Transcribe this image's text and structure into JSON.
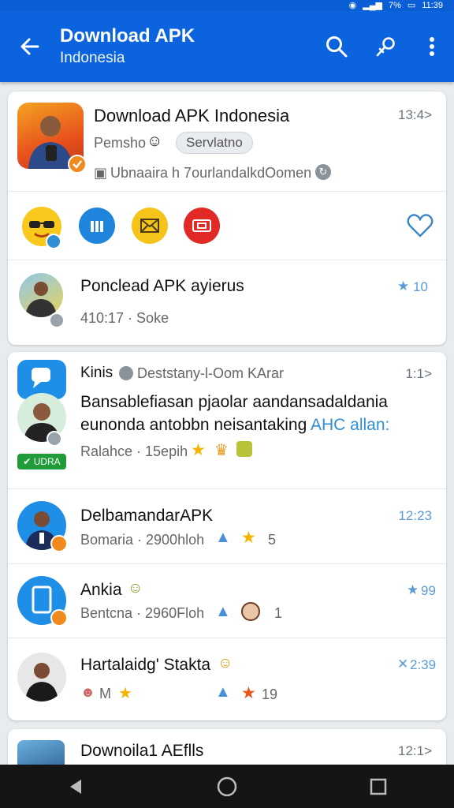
{
  "status_bar": {
    "time": "11:39",
    "battery": "7%"
  },
  "app_bar": {
    "title": "Download APK",
    "subtitle": "Indonesia"
  },
  "featured": {
    "title": "Download APK Indonesia",
    "time": "13:4>",
    "meta": "Pemsho",
    "chip": "Servlatno",
    "desc": "Ubnaaira h 7ourlandalkdOomen",
    "actions": [
      "sunglasses-emoji",
      "chart-icon",
      "mail-icon",
      "camera-icon",
      "heart-icon"
    ]
  },
  "item1": {
    "title": "Ponclead APK ayierus",
    "meta": "410:17 · Soke",
    "time": "10"
  },
  "post": {
    "author": "Kinis",
    "subtitle": "Deststany-l-Oom KArar",
    "time": "1:1>",
    "line1": "Bansablefiasan pjaolar aandansadaldania",
    "line2": "eunonda antobbn neisantaking",
    "link": "AHC allan:",
    "meta": "Ralahce · 15epih",
    "label": "UDRA"
  },
  "list": [
    {
      "title": "DelbamandarAPK",
      "meta": "Bomaria · 2900hloh",
      "time": "12:23",
      "count": "5"
    },
    {
      "title": "Ankia",
      "meta": "Bentcna · 2960Floh",
      "time": "99",
      "count": "1"
    },
    {
      "title": "Hartalaidg' Stakta",
      "meta": "M",
      "time": "2:39",
      "count": "19"
    }
  ],
  "partial": {
    "title": "Downoila1 AEflls",
    "time": "12:1>"
  },
  "colors": {
    "primary": "#0b63de",
    "accent_orange": "#f08a1c",
    "link_blue": "#2f8ed6"
  }
}
